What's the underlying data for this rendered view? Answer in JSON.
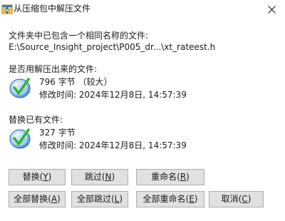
{
  "title": "从压缩包中解压文件",
  "prompt": {
    "line1": "文件夹中已包含一个相同名称的文件:",
    "path": "E:\\Source_Insight_project\\P005_dr...\\xt_rateest.h"
  },
  "new_file": {
    "heading": "是否用解压出来的文件:",
    "size": "796 字节  （较大）",
    "modified": "修改时间: 2024年12月8日, 14:57:39"
  },
  "existing_file": {
    "heading": "替换已有文件:",
    "size": "327 字节",
    "modified": "修改时间: 2024年12月8日, 14:57:39"
  },
  "buttons": {
    "replace": {
      "text": "替换(",
      "key": "Y",
      "tail": ")"
    },
    "skip": {
      "text": "跳过(",
      "key": "N",
      "tail": ")"
    },
    "rename": {
      "text": "重命名(",
      "key": "R",
      "tail": ")"
    },
    "replace_all": {
      "text": "全部替换(",
      "key": "A",
      "tail": ")"
    },
    "skip_all": {
      "text": "全部跳过(",
      "key": "L",
      "tail": ")"
    },
    "rename_all": {
      "text": "全部重命名(",
      "key": "E",
      "tail": ")"
    },
    "cancel": {
      "text": "取消(",
      "key": "C",
      "tail": ")"
    }
  },
  "icons": {
    "title": "archive-icon",
    "close": "close-icon",
    "file": "file-disc-icon"
  },
  "colors": {
    "button_face": "#e1e1e1",
    "button_border": "#adadad",
    "icon_blue": "#2a7fd6",
    "icon_check": "#2fb52f"
  }
}
